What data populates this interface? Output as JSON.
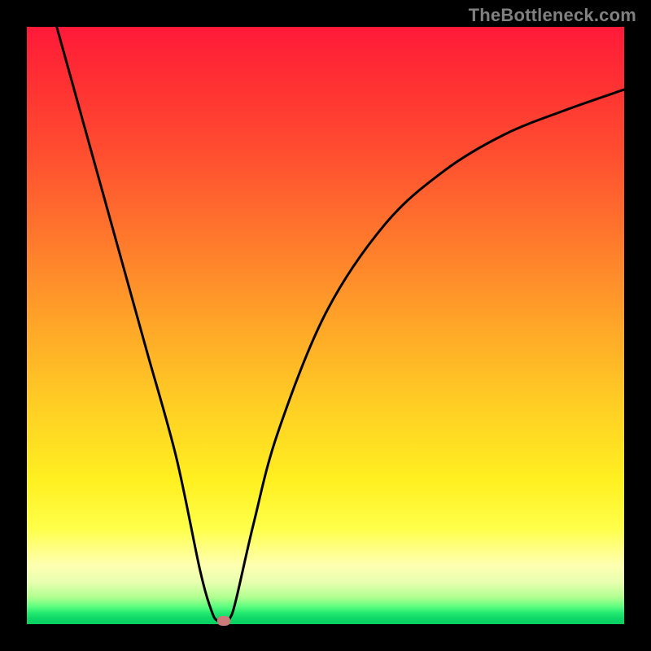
{
  "watermark": "TheBottleneck.com",
  "chart_data": {
    "type": "line",
    "title": "",
    "xlabel": "",
    "ylabel": "",
    "xlim": [
      0,
      1
    ],
    "ylim": [
      0,
      1
    ],
    "legend": false,
    "series": [
      {
        "name": "bottleneck-curve",
        "x": [
          0.05,
          0.1,
          0.15,
          0.2,
          0.25,
          0.29,
          0.31,
          0.32,
          0.33,
          0.34,
          0.35,
          0.38,
          0.42,
          0.5,
          0.6,
          0.7,
          0.8,
          0.9,
          1.0
        ],
        "y": [
          1.0,
          0.82,
          0.64,
          0.46,
          0.28,
          0.09,
          0.02,
          0.005,
          0.0,
          0.01,
          0.04,
          0.17,
          0.32,
          0.52,
          0.67,
          0.76,
          0.82,
          0.86,
          0.895
        ]
      }
    ],
    "marker": {
      "x": 0.33,
      "y": 0.005,
      "color": "#cc7a7a"
    },
    "background_gradient": {
      "top": "#ff1a3a",
      "mid_top": "#ff7a2c",
      "mid": "#ffd024",
      "mid_bottom": "#ffff4a",
      "bottom": "#10d868"
    }
  }
}
